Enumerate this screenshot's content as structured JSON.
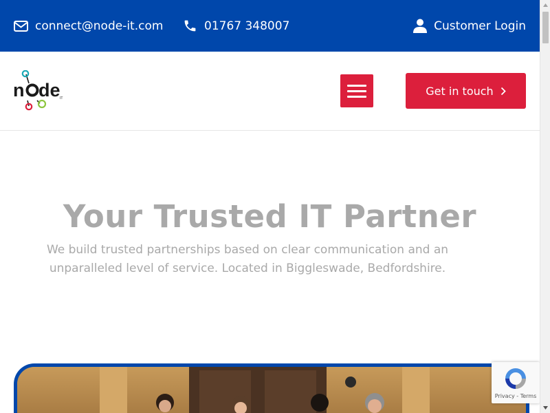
{
  "topbar": {
    "email": "connect@node-it.com",
    "phone": "01767 348007",
    "login": "Customer Login",
    "icons": {
      "email": "envelope-icon",
      "phone": "phone-icon",
      "login": "user-icon"
    },
    "background": "#0047ab"
  },
  "header": {
    "logo_alt": "node",
    "logo_sub": "IT",
    "cta_label": "Get in touch",
    "menu_icon": "hamburger-menu-icon",
    "accent": "#dc1f3c"
  },
  "hero": {
    "title": "Your Trusted IT Partner",
    "subtitle_line1": "We build trusted partnerships based on clear communication and an",
    "subtitle_line2": "unparalleled level of service. Located in Biggleswade, Bedfordshire.",
    "text_color": "#a9a9a9"
  },
  "recaptcha": {
    "privacy": "Privacy",
    "separator": " - ",
    "terms": "Terms"
  }
}
